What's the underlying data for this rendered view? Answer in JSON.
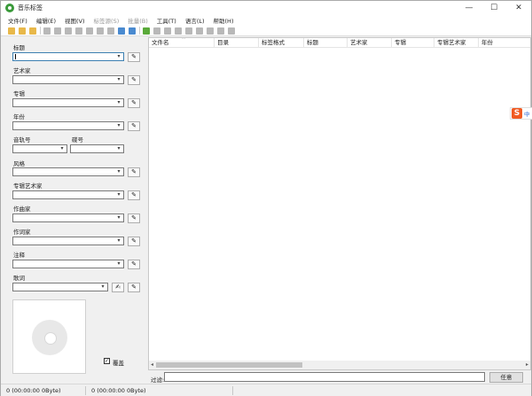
{
  "window": {
    "title": "音乐标签"
  },
  "menu": [
    "文件(F)",
    "编辑(E)",
    "视图(V)",
    "标签源(S)",
    "批量(B)",
    "工具(T)",
    "语言(L)",
    "帮助(H)"
  ],
  "menu_disabled": [
    false,
    false,
    false,
    true,
    true,
    false,
    false,
    false
  ],
  "fields": {
    "title": "标题",
    "artist": "艺术家",
    "album": "专辑",
    "year": "年份",
    "track": "音轨号",
    "disc": "碟号",
    "genre": "风格",
    "album_artist": "专辑艺术家",
    "composer": "作曲家",
    "lyricist": "作词家",
    "comment": "注释",
    "lyrics": "歌词"
  },
  "cover": {
    "overwrite_label": "覆盖",
    "overwrite_checked": "✓"
  },
  "columns": [
    "文件名",
    "目录",
    "标签格式",
    "标题",
    "艺术家",
    "专辑",
    "专辑艺术家",
    "年份"
  ],
  "filter": {
    "label": "过滤:",
    "value": "",
    "button": "任意"
  },
  "status": {
    "selected": "0 (00:00:00 0Byte)",
    "total": "0 (00:00:00 0Byte)"
  },
  "ime": {
    "logo": "S",
    "mode": "中"
  },
  "icons": {
    "dropdown": "▾",
    "wrench": "wrench-icon",
    "edit": "edit-icon"
  }
}
